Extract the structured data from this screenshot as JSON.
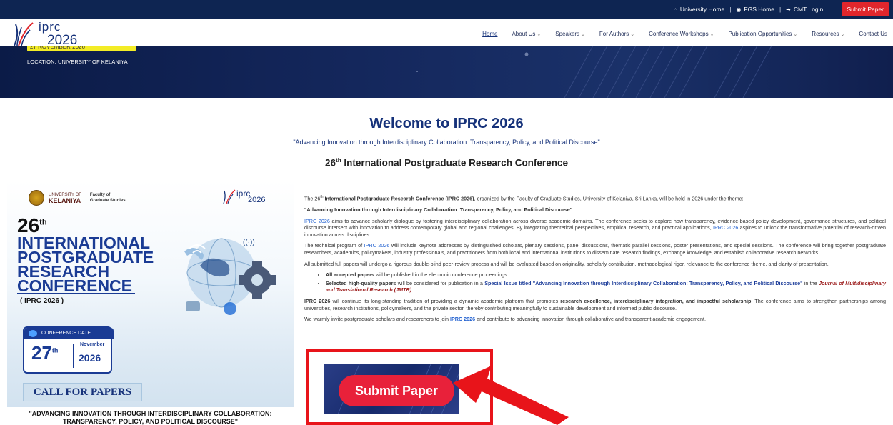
{
  "topbar": {
    "links": [
      {
        "icon": "home-icon",
        "label": "University Home"
      },
      {
        "icon": "globe-icon",
        "label": "FGS Home"
      },
      {
        "icon": "login-icon",
        "label": "CMT Login"
      }
    ],
    "submit_label": "Submit Paper"
  },
  "logo": {
    "name": "iprc",
    "year": "2026"
  },
  "nav": {
    "items": [
      {
        "label": "Home",
        "dropdown": false,
        "active": true
      },
      {
        "label": "About Us",
        "dropdown": true
      },
      {
        "label": "Speakers",
        "dropdown": true
      },
      {
        "label": "For Authors",
        "dropdown": true
      },
      {
        "label": "Conference Workshops",
        "dropdown": true
      },
      {
        "label": "Publication Opportunities",
        "dropdown": true
      },
      {
        "label": "Resources",
        "dropdown": true
      },
      {
        "label": "Contact Us",
        "dropdown": false
      }
    ]
  },
  "hero": {
    "date_badge": "27 NOVEMBER 2026",
    "location": "LOCATION: UNIVERSITY OF KELANIYA"
  },
  "welcome": {
    "title": "Welcome to IPRC 2026",
    "theme": "\"Advancing Innovation through Interdisciplinary Collaboration: Transparency, Policy, and Political Discourse\"",
    "subhead_num": "26",
    "subhead_sup": "th",
    "subhead_rest": " International Postgraduate Research Conference"
  },
  "poster": {
    "uni_small": "UNIVERSITY OF",
    "uni_big": "KELANIYA",
    "faculty_line1": "Faculty of",
    "faculty_line2": "Graduate Studies",
    "logo_name": "iprc",
    "logo_year": "2026",
    "number": "26",
    "number_sup": "th",
    "title_line1": "INTERNATIONAL",
    "title_line2": "POSTGRADUATE",
    "title_line3": "RESEARCH",
    "title_line4": "CONFERENCE",
    "abbr": "( IPRC 2026 )",
    "date_label": "CONFERENCE DATE",
    "day": "27",
    "day_sup": "th",
    "month": "November",
    "year": "2026",
    "cfp": "CALL FOR PAPERS",
    "theme_line1": "\"ADVANCING INNOVATION THROUGH INTERDISCIPLINARY COLLABORATION:",
    "theme_line2": "TRANSPARENCY, POLICY, AND POLITICAL DISCOURSE\""
  },
  "content": {
    "p1_a": "The 26",
    "p1_sup": "th",
    "p1_b": " International Postgraduate Research Conference (IPRC 2026)",
    "p1_c": ", organized by the Faculty of Graduate Studies, University of Kelaniya, Sri Lanka, will be held in 2026 under the theme:",
    "p2": "\"Advancing Innovation through Interdisciplinary Collaboration: Transparency, Policy, and Political Discourse\"",
    "p3_a": "IPRC 2026",
    "p3_b": " aims to advance scholarly dialogue by fostering interdisciplinary collaboration across diverse academic domains. The conference seeks to explore how transparency, evidence-based policy development, governance structures, and political discourse intersect with innovation to address contemporary global and regional challenges. By integrating theoretical perspectives, empirical research, and practical applications, ",
    "p3_c": "IPRC 2026",
    "p3_d": " aspires to unlock the transformative potential of research-driven innovation across disciplines.",
    "p4_a": "The technical program of ",
    "p4_b": "IPRC 2026",
    "p4_c": " will include keynote addresses by distinguished scholars, plenary sessions, panel discussions, thematic parallel sessions, poster presentations, and special sessions. The conference will bring together postgraduate researchers, academics, policymakers, industry professionals, and practitioners from both local and international institutions to disseminate research findings, exchange knowledge, and establish collaborative research networks.",
    "p5": "All submitted full papers will undergo a rigorous double-blind peer-review process and will be evaluated based on originality, scholarly contribution, methodological rigor, relevance to the conference theme, and clarity of presentation.",
    "li1_a": "All accepted papers",
    "li1_b": " will be published in the electronic conference proceedings.",
    "li2_a": "Selected high-quality papers",
    "li2_b": " will be considered for publication in a ",
    "li2_c": "Special Issue titled \"Advancing Innovation through Interdisciplinary Collaboration: Transparency, Policy, and Political Discourse\"",
    "li2_d": " in the ",
    "li2_e": "Journal of Multidisciplinary and Translational Research (JMTR)",
    "li2_f": ".",
    "p6_a": "IPRC 2026",
    "p6_b": " will continue its long-standing tradition of providing a dynamic academic platform that promotes ",
    "p6_c": "research excellence, interdisciplinary integration, and impactful scholarship",
    "p6_d": ". The conference aims to strengthen partnerships among universities, research institutions, policymakers, and the private sector, thereby contributing meaningfully to sustainable development and informed public discourse.",
    "p7_a": "We warmly invite postgraduate scholars and researchers to join ",
    "p7_b": "IPRC 2026",
    "p7_c": " and contribute to advancing innovation through collaborative and transparent academic engagement."
  },
  "submit": {
    "label": "Submit Paper"
  },
  "colors": {
    "navy": "#0e2552",
    "brand_blue": "#16327a",
    "accent_red": "#e0262c",
    "highlight_red": "#e8141a"
  }
}
